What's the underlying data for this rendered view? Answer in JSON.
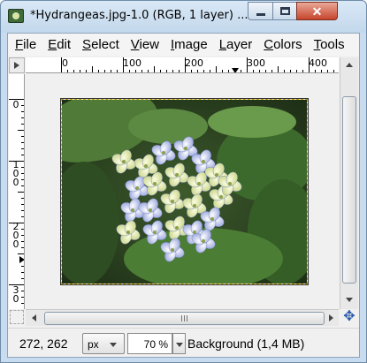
{
  "window": {
    "title": "*Hydrangeas.jpg-1.0 (RGB, 1 layer) ..."
  },
  "icons": {
    "app": "gimp-image-icon",
    "minimize": "minimize-icon",
    "maximize": "maximize-icon",
    "close": "close-icon",
    "navigate": "navigate-icon"
  },
  "menu": [
    {
      "label": "File",
      "accel": "F",
      "rest": "ile"
    },
    {
      "label": "Edit",
      "accel": "E",
      "rest": "dit"
    },
    {
      "label": "Select",
      "accel": "S",
      "rest": "elect"
    },
    {
      "label": "View",
      "accel": "V",
      "rest": "iew"
    },
    {
      "label": "Image",
      "accel": "I",
      "rest": "mage"
    },
    {
      "label": "Layer",
      "accel": "L",
      "rest": "ayer"
    },
    {
      "label": "Colors",
      "accel": "C",
      "rest": "olors"
    },
    {
      "label": "Tools",
      "accel": "T",
      "rest": "ools"
    }
  ],
  "rulers": {
    "horizontal_labels": [
      "0",
      "100",
      "200",
      "300",
      "400"
    ],
    "vertical_labels": [
      "0",
      "1\n0\n0",
      "2\n0\n0",
      "3\n0"
    ]
  },
  "status": {
    "coordinates": "272, 262",
    "unit": "px",
    "zoom": "70 %",
    "message": "Background (1,4 MB)"
  },
  "colors": {
    "title_bar": "#c9dcef",
    "close_button": "#c7452c",
    "selection_marching_ants": "#c8a800"
  }
}
